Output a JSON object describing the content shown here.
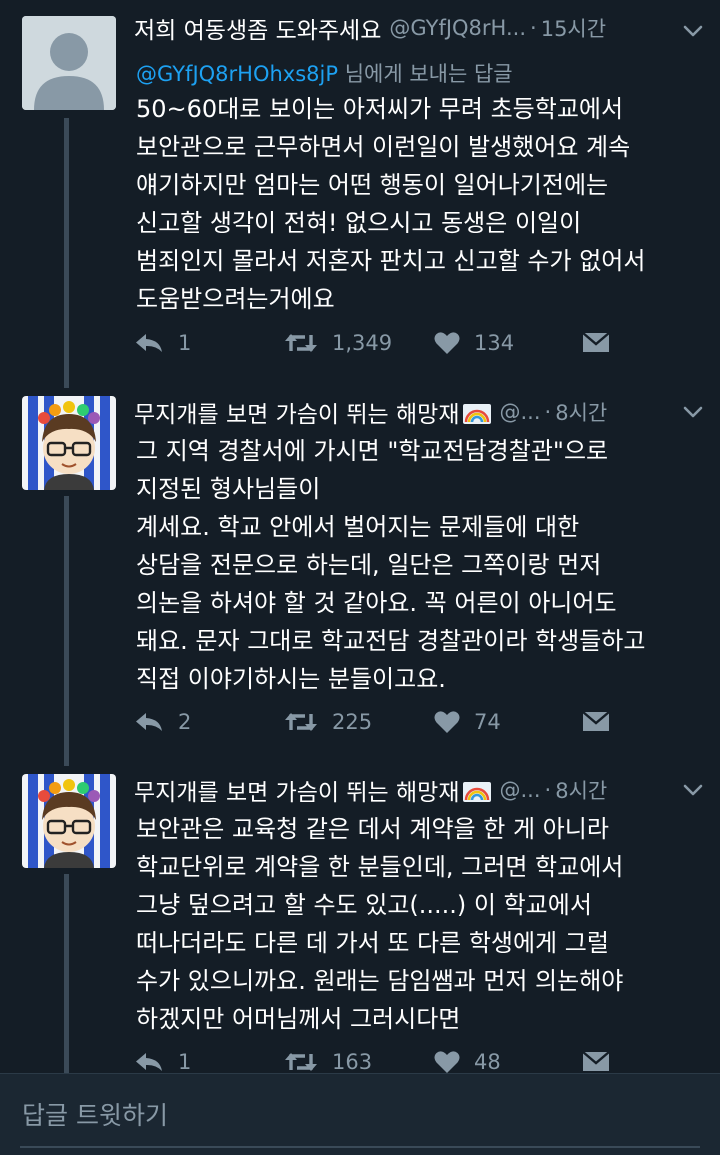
{
  "tweets": [
    {
      "display_name": "저희 여동생좀 도와주세요",
      "handle": "@GYfJQ8rH...",
      "time": "15시간",
      "reply_mention": "@GYfJQ8rHOhxs8jP",
      "reply_suffix": " 님에게 보내는 답글",
      "body": "50~60대로 보이는 아저씨가 무려 초등학교에서\n보안관으로 근무하면서 이런일이 발생했어요 계속\n얘기하지만 엄마는 어떤 행동이 일어나기전에는\n신고할 생각이 전혀! 없으시고 동생은 이일이\n범죄인지 몰라서 저혼자 판치고 신고할 수가 없어서\n도움받으려는거에요",
      "reply_count": "1",
      "retweet_count": "1,349",
      "like_count": "134"
    },
    {
      "display_name": "무지개를 보면 가슴이 뛰는 해망재",
      "handle": "@...",
      "time": "8시간",
      "body": "그 지역 경찰서에 가시면 \"학교전담경찰관\"으로\n지정된 형사님들이\n 계세요. 학교 안에서 벌어지는 문제들에 대한\n상담을 전문으로 하는데, 일단은 그쪽이랑 먼저\n의논을 하셔야 할 것 같아요. 꼭 어른이 아니어도\n돼요. 문자 그대로 학교전담 경찰관이라 학생들하고\n직접 이야기하시는 분들이고요.",
      "reply_count": "2",
      "retweet_count": "225",
      "like_count": "74"
    },
    {
      "display_name": "무지개를 보면 가슴이 뛰는 해망재",
      "handle": "@...",
      "time": "8시간",
      "body": "보안관은 교육청 같은 데서 계약을 한 게 아니라\n학교단위로 계약을 한 분들인데, 그러면 학교에서\n그냥 덮으려고 할 수도 있고(.....) 이 학교에서\n떠나더라도 다른 데 가서 또 다른 학생에게 그럴\n수가 있으니까요. 원래는 담임쌤과 먼저 의논해야\n하겠지만 어머님께서 그러시다면",
      "reply_count": "1",
      "retweet_count": "163",
      "like_count": "48"
    }
  ],
  "compose": {
    "placeholder": "답글 트윗하기"
  },
  "icons": {
    "reply": "reply-icon",
    "retweet": "retweet-icon",
    "like": "heart-icon",
    "dm": "direct-message-icon",
    "more": "chevron-down-icon"
  },
  "colors": {
    "background": "#141d26",
    "text_primary": "#ffffff",
    "text_secondary": "#8899a6",
    "mention": "#1da1f2",
    "icon": "#8899a6"
  }
}
